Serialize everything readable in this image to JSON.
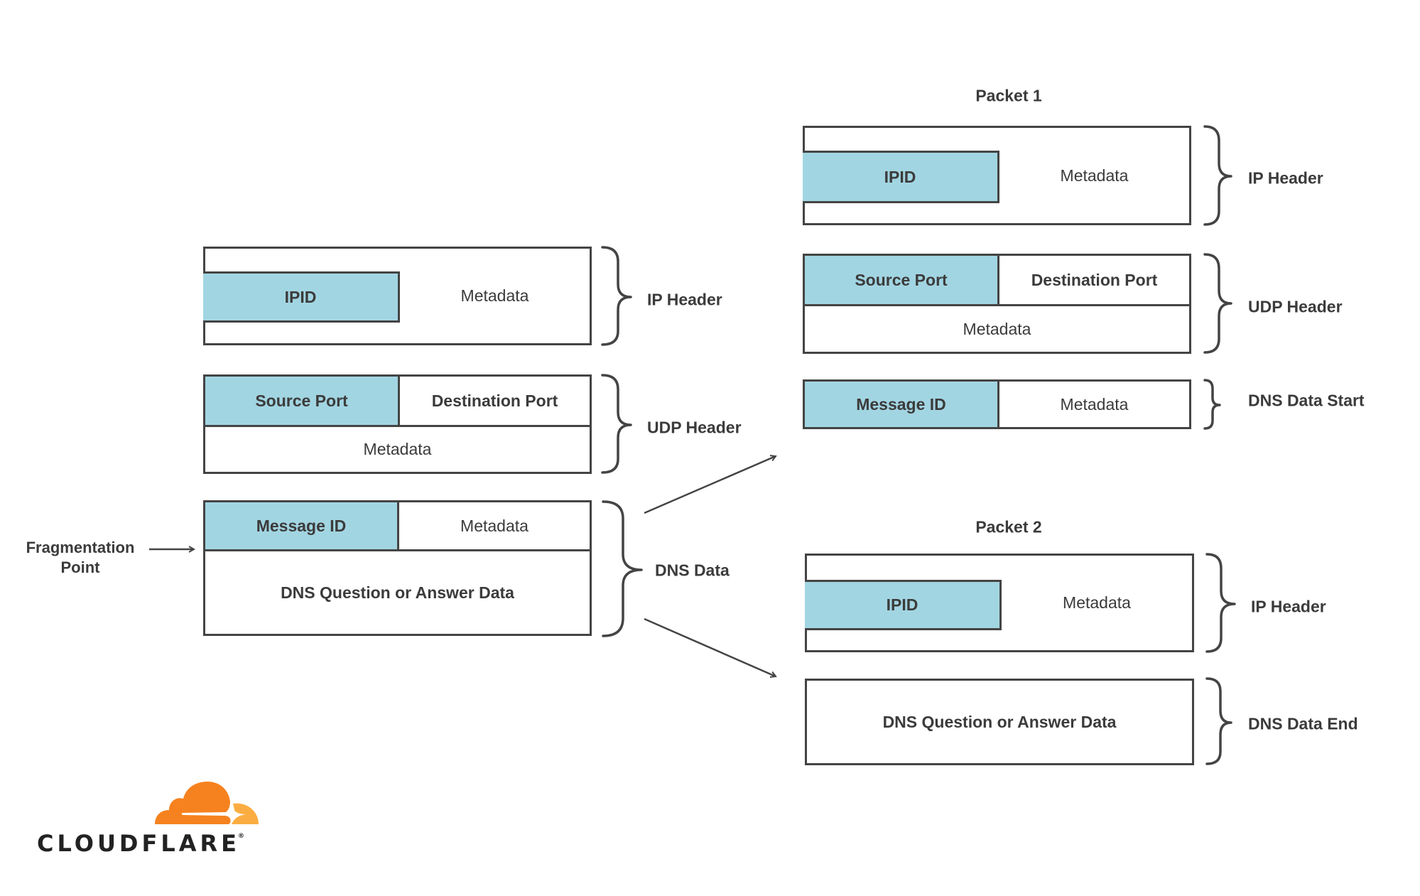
{
  "colors": {
    "field_highlight": "#A2D5E2",
    "border": "#444444",
    "text": "#3b3b3b",
    "logo_orange": "#F6821F",
    "logo_yellow": "#FBAD41"
  },
  "original": {
    "fragmentation_label_line1": "Fragmentation",
    "fragmentation_label_line2": "Point",
    "ip_header": {
      "ipid": "IPID",
      "metadata": "Metadata",
      "bracket_label": "IP Header"
    },
    "udp_header": {
      "source_port": "Source Port",
      "destination_port": "Destination Port",
      "metadata": "Metadata",
      "bracket_label": "UDP Header"
    },
    "dns_data": {
      "message_id": "Message ID",
      "metadata": "Metadata",
      "payload": "DNS Question or Answer Data",
      "bracket_label": "DNS Data"
    }
  },
  "packet1": {
    "title": "Packet 1",
    "ip_header": {
      "ipid": "IPID",
      "metadata": "Metadata",
      "bracket_label": "IP Header"
    },
    "udp_header": {
      "source_port": "Source Port",
      "destination_port": "Destination Port",
      "metadata": "Metadata",
      "bracket_label": "UDP Header"
    },
    "dns_start": {
      "message_id": "Message ID",
      "metadata": "Metadata",
      "bracket_label": "DNS Data Start"
    }
  },
  "packet2": {
    "title": "Packet 2",
    "ip_header": {
      "ipid": "IPID",
      "metadata": "Metadata",
      "bracket_label": "IP Header"
    },
    "dns_end": {
      "payload": "DNS Question or Answer Data",
      "bracket_label": "DNS Data End"
    }
  },
  "logo": {
    "wordmark": "CLOUDFLARE",
    "registered": "®",
    "icon": "cloudflare-cloud-icon"
  }
}
